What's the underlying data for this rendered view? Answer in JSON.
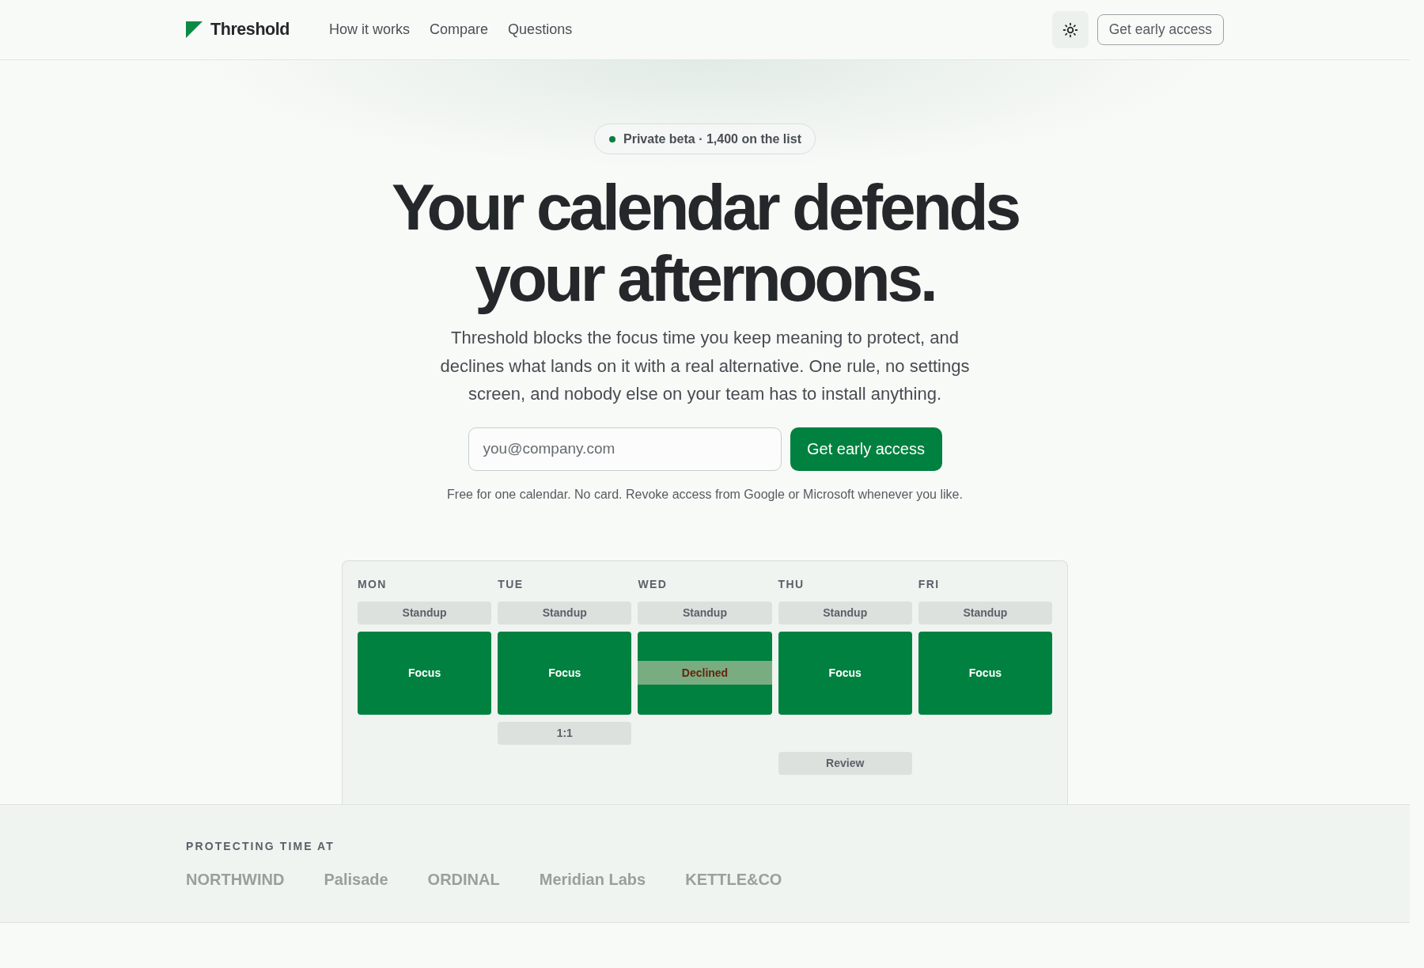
{
  "header": {
    "brand": "Threshold",
    "nav": [
      "How it works",
      "Compare",
      "Questions"
    ],
    "cta": "Get early access"
  },
  "hero": {
    "badge": "Private beta · 1,400 on the list",
    "title": "Your calendar defends your afternoons.",
    "description": "Threshold blocks the focus time you keep meaning to protect, and declines what lands on it with a real alternative. One rule, no settings screen, and nobody else on your team has to install anything.",
    "signup": {
      "placeholder": "you@company.com",
      "button": "Get early access"
    },
    "note": "Free for one calendar. No card. Revoke access from Google or Microsoft whenever you like."
  },
  "calendar": {
    "days": [
      {
        "label": "MON",
        "events": [
          {
            "kind": "standup",
            "label": "Standup"
          },
          {
            "kind": "focus",
            "label": "Focus"
          }
        ]
      },
      {
        "label": "TUE",
        "events": [
          {
            "kind": "standup",
            "label": "Standup"
          },
          {
            "kind": "focus",
            "label": "Focus"
          },
          {
            "kind": "meeting",
            "label": "1:1"
          }
        ]
      },
      {
        "label": "WED",
        "events": [
          {
            "kind": "standup",
            "label": "Standup"
          },
          {
            "kind": "declined",
            "label": "Declined"
          }
        ]
      },
      {
        "label": "THU",
        "events": [
          {
            "kind": "standup",
            "label": "Standup"
          },
          {
            "kind": "focus",
            "label": "Focus"
          },
          {
            "kind": "review",
            "label": "Review"
          }
        ]
      },
      {
        "label": "FRI",
        "events": [
          {
            "kind": "standup",
            "label": "Standup"
          },
          {
            "kind": "focus",
            "label": "Focus"
          }
        ]
      }
    ]
  },
  "logos": {
    "heading": "PROTECTING TIME AT",
    "names": [
      "NORTHWIND",
      "Palisade",
      "ORDINAL",
      "Meridian Labs",
      "KETTLE&CO"
    ]
  }
}
